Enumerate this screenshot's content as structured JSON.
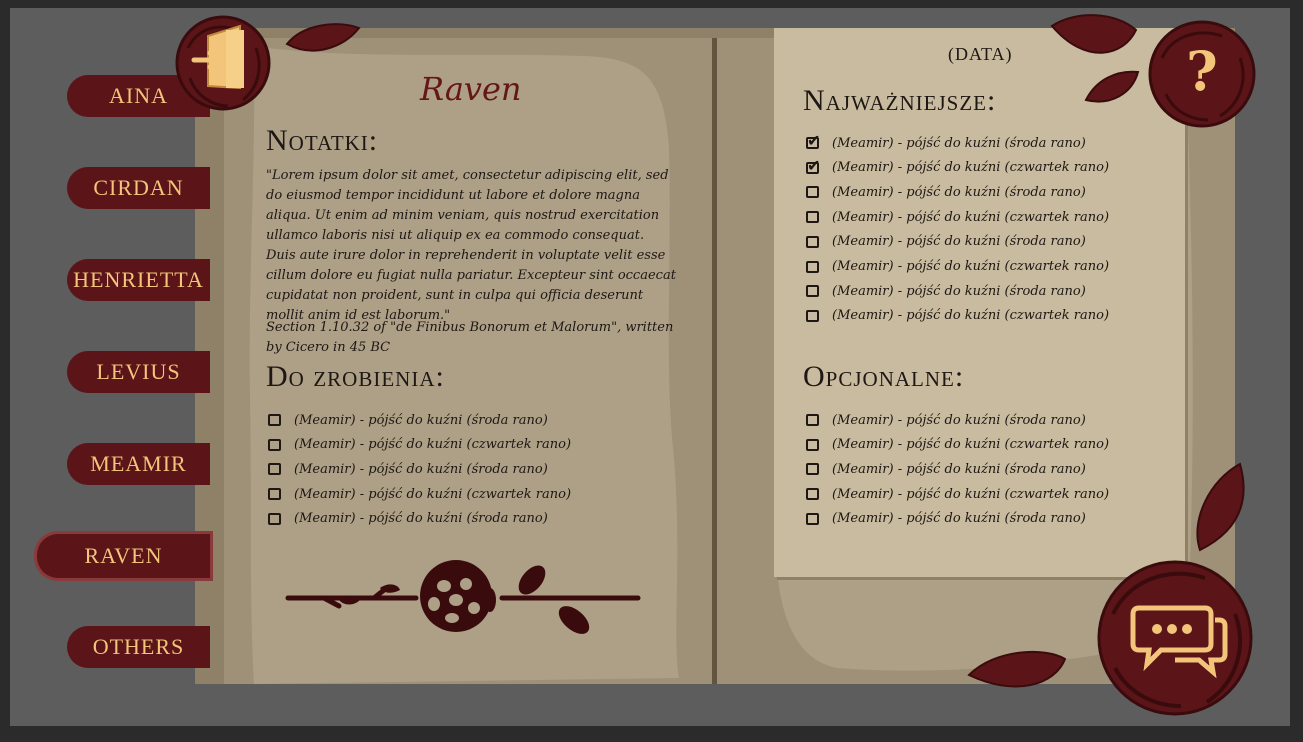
{
  "characters": [
    "AINA",
    "CIRDAN",
    "HENRIETTA",
    "LEVIUS",
    "MEAMIR",
    "RAVEN",
    "OTHERS"
  ],
  "active_character": "RAVEN",
  "left_page": {
    "character_name": "Raven",
    "notes_heading": "Notatki:",
    "notes_text": "\"Lorem ipsum dolor sit amet, consectetur adipiscing elit, sed do eiusmod tempor incididunt ut labore et dolore magna aliqua. Ut enim ad minim veniam, quis nostrud exercitation ullamco laboris nisi ut aliquip ex ea commodo consequat. Duis aute irure dolor in reprehenderit in voluptate velit esse cillum dolore eu fugiat nulla pariatur. Excepteur sint occaecat cupidatat non proident, sunt in culpa qui officia deserunt mollit anim id est laborum.\"",
    "notes_citation": "Section 1.10.32 of \"de Finibus Bonorum et Malorum\", written by Cicero in 45 BC",
    "todo_heading": "Do zrobienia:",
    "todo": [
      {
        "text": "(Meamir) - pójść do kuźni (środa rano)",
        "checked": false
      },
      {
        "text": "(Meamir) - pójść do kuźni (czwartek rano)",
        "checked": false
      },
      {
        "text": "(Meamir) - pójść do kuźni (środa rano)",
        "checked": false
      },
      {
        "text": "(Meamir) - pójść do kuźni (czwartek rano)",
        "checked": false
      },
      {
        "text": "(Meamir) - pójść do kuźni (środa rano)",
        "checked": false
      }
    ]
  },
  "right_page": {
    "date_label": "(DATA)",
    "important_heading": "Najważniejsze:",
    "important": [
      {
        "text": "(Meamir) - pójść do kuźni (środa rano)",
        "checked": true
      },
      {
        "text": "(Meamir) - pójść do kuźni (czwartek rano)",
        "checked": true
      },
      {
        "text": "(Meamir) - pójść do kuźni (środa rano)",
        "checked": false
      },
      {
        "text": "(Meamir) - pójść do kuźni (czwartek rano)",
        "checked": false
      },
      {
        "text": "(Meamir) - pójść do kuźni (środa rano)",
        "checked": false
      },
      {
        "text": "(Meamir) - pójść do kuźni (czwartek rano)",
        "checked": false
      },
      {
        "text": "(Meamir) - pójść do kuźni (środa rano)",
        "checked": false
      },
      {
        "text": "(Meamir) - pójść do kuźni (czwartek rano)",
        "checked": false
      }
    ],
    "optional_heading": "Opcjonalne:",
    "optional": [
      {
        "text": "(Meamir) - pójść do kuźni (środa rano)",
        "checked": false
      },
      {
        "text": "(Meamir) - pójść do kuźni (czwartek rano)",
        "checked": false
      },
      {
        "text": "(Meamir) - pójść do kuźni (środa rano)",
        "checked": false
      },
      {
        "text": "(Meamir) - pójść do kuźni (czwartek rano)",
        "checked": false
      },
      {
        "text": "(Meamir) - pójść do kuźni (środa rano)",
        "checked": false
      }
    ]
  },
  "icons": {
    "exit": "exit-door-icon",
    "help": "question-mark-icon",
    "chat": "chat-bubbles-icon"
  },
  "colors": {
    "rose": "#5b1418",
    "accent_gold": "#f2c57a",
    "paper": "#c8bb9f",
    "book": "#8e8168"
  }
}
